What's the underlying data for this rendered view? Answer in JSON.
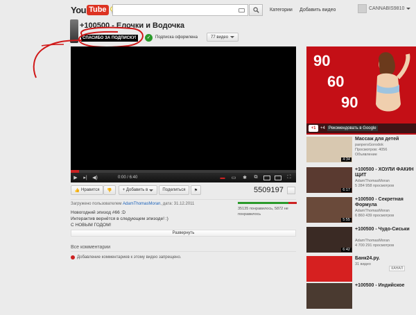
{
  "header": {
    "logo_you": "You",
    "logo_tube": "Tube",
    "search_value": "",
    "nav": [
      "Категории",
      "Добавить видео"
    ],
    "username": "CANNABIS9810"
  },
  "video": {
    "title": "+100500 - Елочки и Водочка",
    "badge": "СПАСИБО ЗА ПОДПИСКУ!",
    "subscribed_label": "Подписка оформлена",
    "videos_button": "77 видео",
    "time": "0:00 / 6:40",
    "progress_loaded": 0.0,
    "progress_played": 0.0
  },
  "actions": {
    "like": "Нравится",
    "add": "+ Добавить в",
    "share": "Поделиться",
    "views": "5509197"
  },
  "info": {
    "uploaded_prefix": "Загружено пользователем",
    "uploader": "AdamThomasMoran",
    "uploaded_date": ", дата: 31.12.2011",
    "description": [
      "Новогодний эпизод #66 :D",
      "Интерактив вернётся в следующем эпизоде! :)",
      "С НОВЫМ ГОДОМ!"
    ],
    "likes_text": "35135 понравилось, 5872 не понравилось",
    "like_ratio": 0.857,
    "expand": "Развернуть"
  },
  "comments": {
    "heading": "Все комментарии",
    "note": "Добавление комментариев к этому видео запрещено."
  },
  "ad": {
    "numbers": [
      "90",
      "60",
      "90"
    ],
    "plus_count": "+4",
    "recommend": "Рекомендовать в Google"
  },
  "related": [
    {
      "title": "Массаж для детей",
      "sub1": "panpersGorodok",
      "sub2": "Просмотров: 4056",
      "sub3": "Объявление",
      "duration": "4:34",
      "color": "#d8c8b0"
    },
    {
      "title": "+100500 - ХОУЛИ ФАКИН ЩИТ",
      "sub1": "AdamThomasMoran",
      "sub2": "5 284 958 просмотров",
      "sub3": "",
      "duration": "6:17",
      "color": "#5a3a30"
    },
    {
      "title": "+100500 - Секретная Формула",
      "sub1": "AdamThomasMoran",
      "sub2": "6 860 439 просмотров",
      "sub3": "",
      "duration": "5:55",
      "color": "#6a4a3a"
    },
    {
      "title": "+100500 - Чудо-Сиськи",
      "sub1": "AdamThomasMoran",
      "sub2": "4 700 291 просмотров",
      "sub3": "",
      "duration": "6:42",
      "color": "#3a2a24"
    },
    {
      "title": "Банк24.ру.",
      "sub1": "31 видео",
      "sub2": "",
      "sub3": "",
      "duration": "",
      "color": "#d62020",
      "badge": "КАНАЛ"
    },
    {
      "title": "+100500 - Индийское",
      "sub1": "",
      "sub2": "",
      "sub3": "",
      "duration": "",
      "color": "#4a3a30"
    }
  ]
}
